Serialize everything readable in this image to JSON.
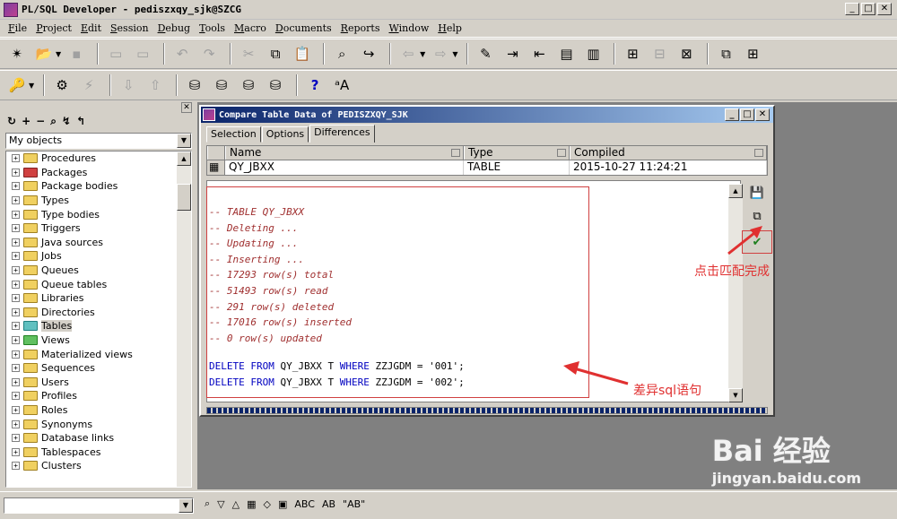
{
  "window": {
    "title": "PL/SQL Developer - pediszxqy_sjk@SZCG",
    "min": "_",
    "max": "□",
    "close": "✕"
  },
  "menu": [
    "File",
    "Project",
    "Edit",
    "Session",
    "Debug",
    "Tools",
    "Macro",
    "Documents",
    "Reports",
    "Window",
    "Help"
  ],
  "browser": {
    "close": "✕",
    "tools": [
      "↻",
      "+",
      "−",
      "⌕",
      "↯",
      "↰"
    ],
    "filter": "My objects",
    "items": [
      {
        "label": "Procedures",
        "color": "yellow"
      },
      {
        "label": "Packages",
        "color": "red"
      },
      {
        "label": "Package bodies",
        "color": "yellow"
      },
      {
        "label": "Types",
        "color": "yellow"
      },
      {
        "label": "Type bodies",
        "color": "yellow"
      },
      {
        "label": "Triggers",
        "color": "yellow"
      },
      {
        "label": "Java sources",
        "color": "yellow"
      },
      {
        "label": "Jobs",
        "color": "yellow"
      },
      {
        "label": "Queues",
        "color": "yellow"
      },
      {
        "label": "Queue tables",
        "color": "yellow"
      },
      {
        "label": "Libraries",
        "color": "yellow"
      },
      {
        "label": "Directories",
        "color": "yellow"
      },
      {
        "label": "Tables",
        "color": "teal",
        "selected": true
      },
      {
        "label": "Views",
        "color": "green"
      },
      {
        "label": "Materialized views",
        "color": "yellow"
      },
      {
        "label": "Sequences",
        "color": "yellow"
      },
      {
        "label": "Users",
        "color": "yellow"
      },
      {
        "label": "Profiles",
        "color": "yellow"
      },
      {
        "label": "Roles",
        "color": "yellow"
      },
      {
        "label": "Synonyms",
        "color": "yellow"
      },
      {
        "label": "Database links",
        "color": "yellow"
      },
      {
        "label": "Tablespaces",
        "color": "yellow"
      },
      {
        "label": "Clusters",
        "color": "yellow"
      }
    ]
  },
  "compare": {
    "title": "Compare Table Data of PEDISZXQY_SJK",
    "tabs": [
      "Selection",
      "Options",
      "Differences"
    ],
    "active_tab": "Differences",
    "columns": [
      "Name",
      "Type",
      "Compiled"
    ],
    "row": {
      "name": "QY_JBXX",
      "type": "TABLE",
      "compiled": "2015-10-27 11:24:21"
    },
    "comments": [
      "-- TABLE QY_JBXX",
      "-- Deleting ...",
      "-- Updating ...",
      "-- Inserting ...",
      "-- 17293 row(s) total",
      "-- 51493 row(s) read",
      "-- 291 row(s) deleted",
      "-- 17016 row(s) inserted",
      "-- 0 row(s) updated"
    ],
    "sql": [
      {
        "kw1": "DELETE FROM",
        "tbl": " QY_JBXX T ",
        "kw2": "WHERE",
        "rest": " ZZJGDM = '001';"
      },
      {
        "kw1": "DELETE FROM",
        "tbl": " QY_JBXX T ",
        "kw2": "WHERE",
        "rest": " ZZJGDM = '002';"
      }
    ]
  },
  "annotations": {
    "apply": "点击匹配完成",
    "diff_sql": "差异sql语句"
  },
  "watermark": {
    "main": "Bai 经验",
    "sub": "jingyan.baidu.com"
  },
  "bottom_tools": [
    "⌕",
    "▽",
    "△",
    "▦",
    "◇",
    "▣",
    "ABC",
    "AB",
    "\"AB\""
  ]
}
